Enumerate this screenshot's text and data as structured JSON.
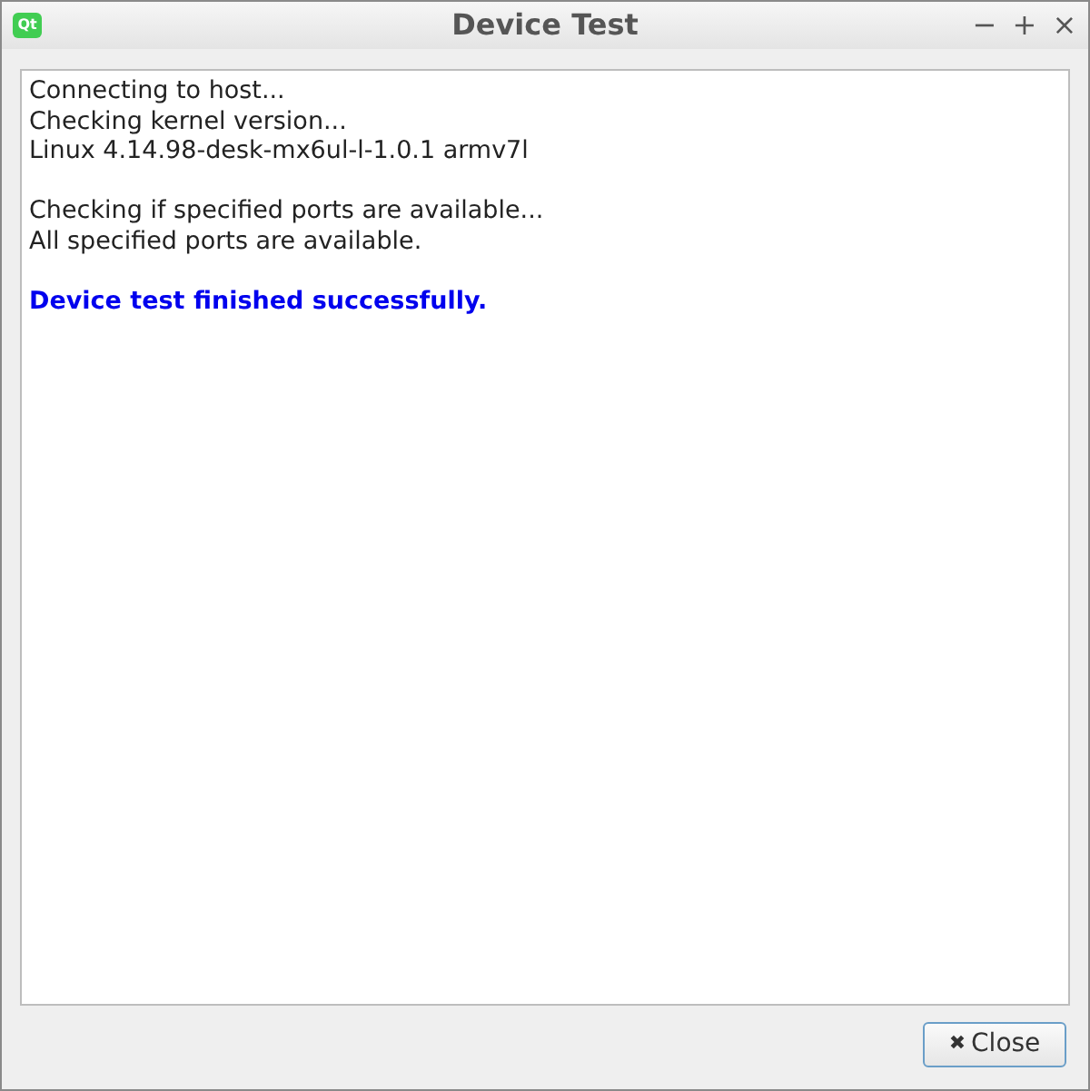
{
  "window": {
    "logo_text": "Qt",
    "title": "Device Test",
    "controls": [
      "−",
      "+",
      "×"
    ]
  },
  "log_groups": [
    {
      "kind": "normal",
      "lines": [
        "Connecting to host...",
        "Checking kernel version...",
        "Linux 4.14.98-desk-mx6ul-l-1.0.1 armv7l"
      ]
    },
    {
      "kind": "normal",
      "lines": [
        "Checking if specified ports are available...",
        "All specified ports are available."
      ]
    },
    {
      "kind": "success",
      "lines": [
        "Device test finished successfully."
      ]
    }
  ],
  "buttons": [
    {
      "icon": "✖",
      "label": "Close"
    }
  ]
}
